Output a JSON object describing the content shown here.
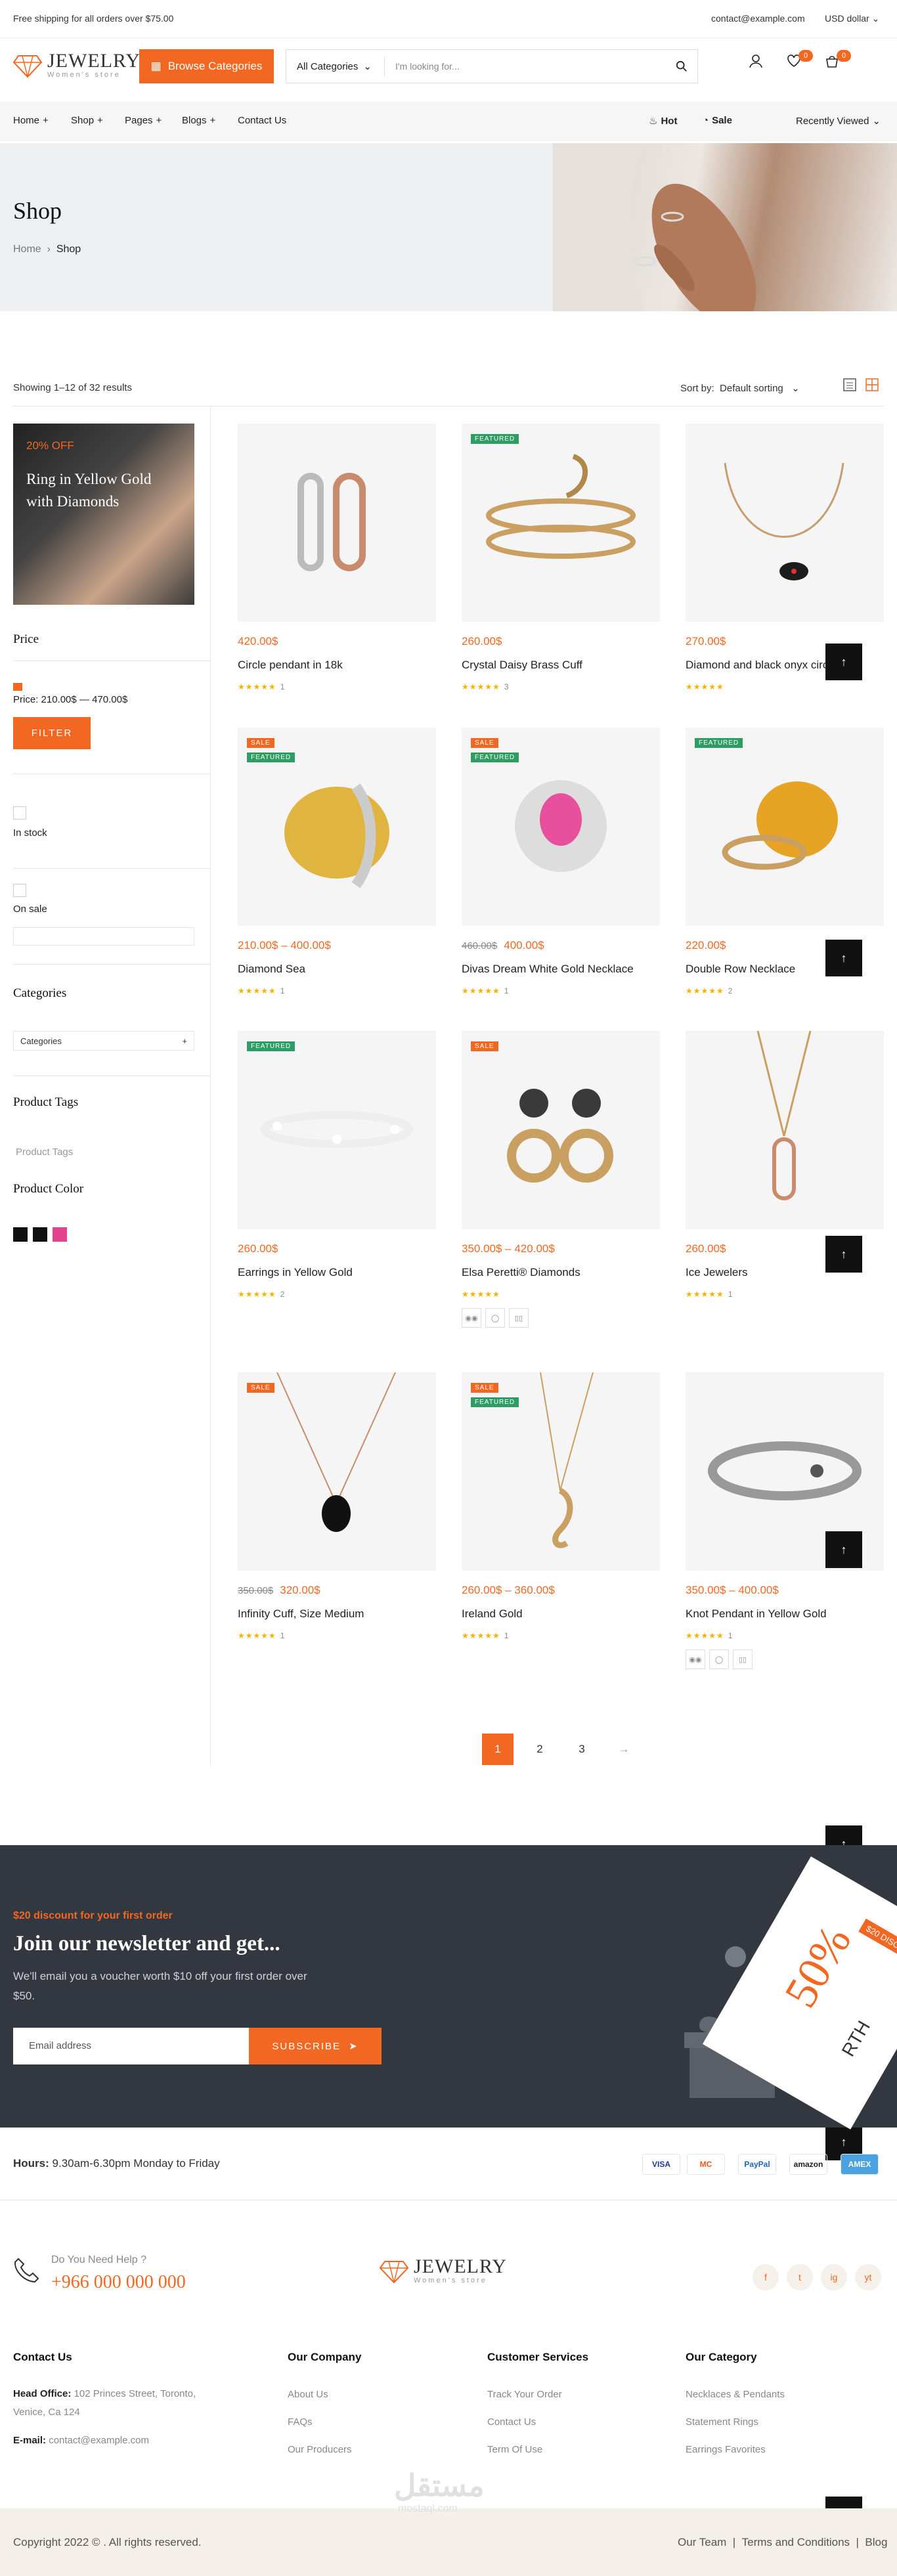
{
  "topbar": {
    "shipping": "Free shipping for all orders over $75.00",
    "email": "contact@example.com",
    "currency": "USD dollar"
  },
  "header": {
    "logo_name": "JEWELRY",
    "logo_tag": "Women's store",
    "browse_label": "Browse Categories",
    "search_category": "All Categories",
    "search_placeholder": "I'm looking for...",
    "wishlist_count": "0",
    "cart_count": "0"
  },
  "nav": {
    "items": [
      "Home",
      "Shop",
      "Pages",
      "Blogs",
      "Contact Us"
    ],
    "hot": "Hot",
    "sale": "Sale",
    "recent": "Recently Viewed"
  },
  "hero": {
    "title": "Shop",
    "breadcrumb_home": "Home",
    "breadcrumb_current": "Shop"
  },
  "toolbar": {
    "results": "Showing 1–12 of 32 results",
    "sort_label": "Sort by:",
    "sort_value": "Default sorting"
  },
  "sidebar": {
    "promo_off": "20% OFF",
    "promo_title": "Ring in Yellow Gold with Diamonds",
    "price_heading": "Price",
    "price_range": "Price: 210.00$ — 470.00$",
    "filter_label": "FILTER",
    "in_stock": "In stock",
    "on_sale": "On sale",
    "categories_heading": "Categories",
    "categories_select": "Categories",
    "tags_heading": "Product Tags",
    "tags_placeholder": "Product Tags",
    "color_heading": "Product Color",
    "colors": [
      "#111111",
      "#111111",
      "#e4418f"
    ]
  },
  "products": [
    {
      "title": "Circle pendant in 18k",
      "price": "420.00$",
      "old": "",
      "tags": [],
      "reviews": "1"
    },
    {
      "title": "Crystal Daisy Brass Cuff",
      "price": "260.00$",
      "old": "",
      "tags": [
        "FEATURED"
      ],
      "reviews": "3"
    },
    {
      "title": "Diamond and black onyx circle",
      "price": "270.00$",
      "old": "",
      "tags": [],
      "reviews": ""
    },
    {
      "title": "Diamond Sea",
      "price": "210.00$ – 400.00$",
      "old": "",
      "tags": [
        "SALE",
        "FEATURED"
      ],
      "reviews": "1"
    },
    {
      "title": "Divas Dream White Gold Necklace",
      "price": "400.00$",
      "old": "460.00$",
      "tags": [
        "SALE",
        "FEATURED"
      ],
      "reviews": "1"
    },
    {
      "title": "Double Row Necklace",
      "price": "220.00$",
      "old": "",
      "tags": [
        "FEATURED"
      ],
      "reviews": "2"
    },
    {
      "title": "Earrings in Yellow Gold",
      "price": "260.00$",
      "old": "",
      "tags": [
        "FEATURED"
      ],
      "reviews": "2"
    },
    {
      "title": "Elsa Peretti® Diamonds",
      "price": "350.00$ – 420.00$",
      "old": "",
      "tags": [
        "SALE"
      ],
      "reviews": ""
    },
    {
      "title": "Ice Jewelers",
      "price": "260.00$",
      "old": "",
      "tags": [],
      "reviews": "1"
    },
    {
      "title": "Infinity Cuff, Size Medium",
      "price": "320.00$",
      "old": "350.00$",
      "tags": [
        "SALE"
      ],
      "reviews": "1"
    },
    {
      "title": "Ireland Gold",
      "price": "260.00$ – 360.00$",
      "old": "",
      "tags": [
        "SALE",
        "FEATURED"
      ],
      "reviews": "1"
    },
    {
      "title": "Knot Pendant in Yellow Gold",
      "price": "350.00$ – 400.00$",
      "old": "",
      "tags": [],
      "reviews": "1"
    }
  ],
  "pagination": {
    "pages": [
      "1",
      "2",
      "3"
    ],
    "next": "→"
  },
  "newsletter": {
    "discount": "$20 discount for your first order",
    "title": "Join our newsletter and get...",
    "text": "We'll email you a voucher worth $10 off your first order over $50.",
    "email_placeholder": "Email address",
    "subscribe": "SUBSCRIBE",
    "ticket_big": "50%",
    "ticket_small": "$20 DISC",
    "ticket_side": "RTH"
  },
  "footer": {
    "hours_label": "Hours:",
    "hours_value": "9.30am-6.30pm Monday to Friday",
    "payments": [
      "VISA",
      "MC",
      "PayPal",
      "amazon",
      "AMEX"
    ],
    "help_label": "Do You Need Help ?",
    "phone": "+966 000 000 000",
    "social": [
      "f",
      "t",
      "ig",
      "yt"
    ],
    "contact_heading": "Contact Us",
    "head_office_label": "Head Office:",
    "head_office": "102 Princes Street, Toronto, Venice, Ca 124",
    "email_label": "E-mail:",
    "email": "contact@example.com",
    "columns": [
      {
        "heading": "Our Company",
        "links": [
          "About Us",
          "FAQs",
          "Our Producers"
        ]
      },
      {
        "heading": "Customer Services",
        "links": [
          "Track Your Order",
          "Contact Us",
          "Term Of Use"
        ]
      },
      {
        "heading": "Our Category",
        "links": [
          "Necklaces & Pendants",
          "Statement Rings",
          "Earrings Favorites"
        ]
      }
    ],
    "copyright": "Copyright 2022 © . All rights reserved.",
    "bottom_links": [
      "Our Team",
      "Terms and Conditions",
      "Blog"
    ],
    "watermark": "مستقل",
    "watermark_sub": "mostaql.com"
  }
}
